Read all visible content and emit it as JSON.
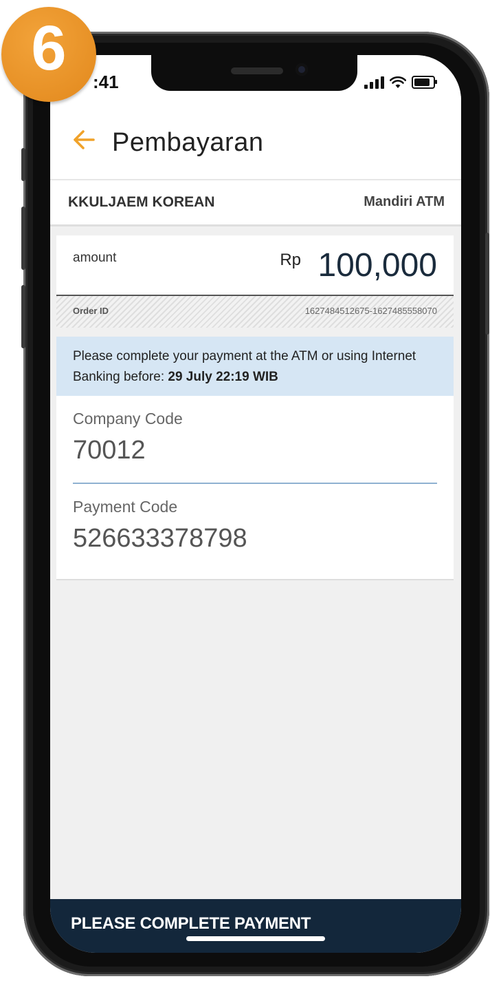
{
  "badge": {
    "step": "6"
  },
  "status_bar": {
    "time": ":41",
    "icons": [
      "signal-icon",
      "wifi-icon",
      "battery-icon"
    ]
  },
  "header": {
    "back_icon": "back-arrow-icon",
    "title": "Pembayaran"
  },
  "merchant": {
    "name": "KKULJAEM KOREAN",
    "method": "Mandiri ATM"
  },
  "payment": {
    "amount_label": "amount",
    "currency": "Rp",
    "amount": "100,000",
    "order_id_label": "Order ID",
    "order_id": "1627484512675-1627485558070"
  },
  "notice": {
    "text": "Please complete your payment at the ATM or using Internet Banking before: ",
    "deadline": "29 July 22:19 WIB"
  },
  "codes": {
    "company_label": "Company Code",
    "company_value": "70012",
    "payment_label": "Payment Code",
    "payment_value": "526633378798"
  },
  "footer": {
    "button_label": "PLEASE COMPLETE PAYMENT"
  },
  "colors": {
    "accent": "#f0a22a",
    "navy": "#13273b",
    "notice_bg": "#d6e6f4",
    "badge": "#e8921f"
  }
}
